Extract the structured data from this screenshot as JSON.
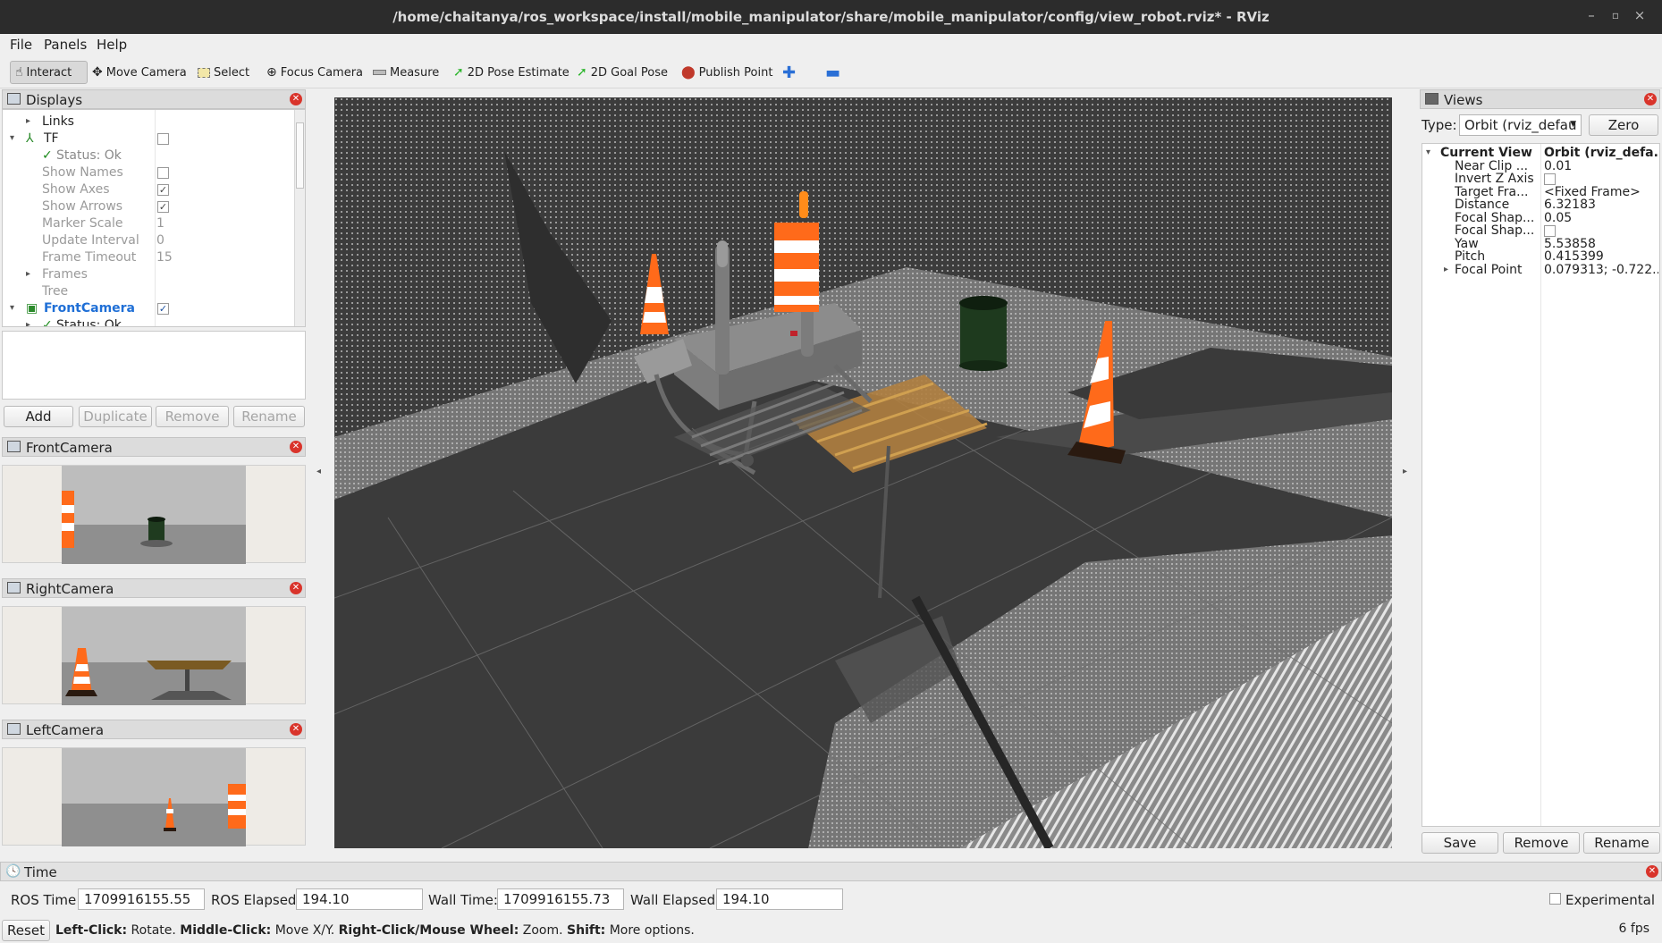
{
  "window": {
    "title": "/home/chaitanya/ros_workspace/install/mobile_manipulator/share/mobile_manipulator/config/view_robot.rviz* - RViz",
    "minimize": "–",
    "maximize": "▫",
    "close": "×"
  },
  "menu": [
    "File",
    "Panels",
    "Help"
  ],
  "toolbar": [
    {
      "label": "Interact",
      "icon": "pointer-icon"
    },
    {
      "label": "Move Camera",
      "icon": "move-icon"
    },
    {
      "label": "Select",
      "icon": "select-icon"
    },
    {
      "label": "Focus Camera",
      "icon": "focus-icon"
    },
    {
      "label": "Measure",
      "icon": "ruler-icon"
    },
    {
      "label": "2D Pose Estimate",
      "icon": "green-arrow-icon"
    },
    {
      "label": "2D Goal Pose",
      "icon": "green-arrow-icon"
    },
    {
      "label": "Publish Point",
      "icon": "map-pin-icon"
    }
  ],
  "displays": {
    "title": "Displays",
    "rows": [
      {
        "name": "Links",
        "indent": 1,
        "arrow": "▸"
      },
      {
        "name": "TF",
        "indent": 0,
        "arrow": "▾",
        "checkbox": false
      },
      {
        "name": "Status: Ok",
        "indent": 1,
        "status": true
      },
      {
        "name": "Show Names",
        "indent": 1,
        "checkbox": false,
        "disabled": true
      },
      {
        "name": "Show Axes",
        "indent": 1,
        "checkbox": true,
        "disabled": true
      },
      {
        "name": "Show Arrows",
        "indent": 1,
        "checkbox": true,
        "disabled": true
      },
      {
        "name": "Marker Scale",
        "indent": 1,
        "value": "1",
        "disabled": true
      },
      {
        "name": "Update Interval",
        "indent": 1,
        "value": "0",
        "disabled": true
      },
      {
        "name": "Frame Timeout",
        "indent": 1,
        "value": "15",
        "disabled": true
      },
      {
        "name": "Frames",
        "indent": 1,
        "arrow": "▸",
        "disabled": true
      },
      {
        "name": "Tree",
        "indent": 1,
        "disabled": true
      },
      {
        "name": "FrontCamera",
        "indent": 0,
        "arrow": "▾",
        "checkbox": true,
        "highlight": true
      },
      {
        "name": "Status: Ok",
        "indent": 1,
        "arrow": "▸",
        "status": true
      }
    ],
    "buttons": [
      "Add",
      "Duplicate",
      "Remove",
      "Rename"
    ]
  },
  "cameras": [
    {
      "title": "FrontCamera"
    },
    {
      "title": "RightCamera"
    },
    {
      "title": "LeftCamera"
    }
  ],
  "views": {
    "title": "Views",
    "type_label": "Type:",
    "type_value": "Orbit (rviz_defau",
    "zero": "Zero",
    "rows": [
      {
        "name": "Current View",
        "value": "Orbit (rviz_defa...",
        "bold": true,
        "arrow": "▾"
      },
      {
        "name": "Near Clip ...",
        "value": "0.01"
      },
      {
        "name": "Invert Z Axis",
        "checkbox": false
      },
      {
        "name": "Target Fra...",
        "value": "<Fixed Frame>"
      },
      {
        "name": "Distance",
        "value": "6.32183"
      },
      {
        "name": "Focal Shap...",
        "value": "0.05"
      },
      {
        "name": "Focal Shap...",
        "checkbox": false
      },
      {
        "name": "Yaw",
        "value": "5.53858"
      },
      {
        "name": "Pitch",
        "value": "0.415399"
      },
      {
        "name": "Focal Point",
        "value": "0.079313; -0.722...",
        "arrow": "▸"
      }
    ],
    "buttons": [
      "Save",
      "Remove",
      "Rename"
    ]
  },
  "time": {
    "title": "Time",
    "ros_time_label": "ROS Time:",
    "ros_time": "1709916155.55",
    "ros_elapsed_label": "ROS Elapsed:",
    "ros_elapsed": "194.10",
    "wall_time_label": "Wall Time:",
    "wall_time": "1709916155.73",
    "wall_elapsed_label": "Wall Elapsed:",
    "wall_elapsed": "194.10",
    "experimental": "Experimental"
  },
  "status": {
    "reset": "Reset",
    "left_click": "Left-Click:",
    "left_click_desc": " Rotate. ",
    "middle_click": "Middle-Click:",
    "middle_click_desc": " Move X/Y. ",
    "right_click": "Right-Click/Mouse Wheel:",
    "right_click_desc": " Zoom. ",
    "shift": "Shift:",
    "shift_desc": " More options.",
    "fps": "6 fps"
  },
  "colors": {
    "cone_orange": "#ff6a1a",
    "checkbox_green": "#1a8a1a",
    "highlight_blue": "#1f6fd6",
    "floor_dark": "#3a3a3a",
    "floor_light": "#8a8a8a"
  }
}
